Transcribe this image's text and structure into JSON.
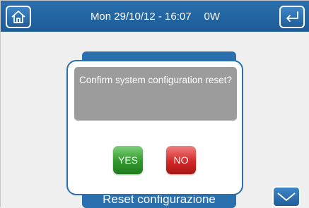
{
  "header": {
    "datetime": "Mon 29/10/12 - 16:07",
    "power": "0W",
    "home_icon": "home-icon",
    "back_icon": "return-arrow-icon"
  },
  "background_screen": {
    "menu_item_label": "Reset configurazione",
    "scroll_down_icon": "chevron-down-icon"
  },
  "dialog": {
    "message": "Confirm system configuration reset?",
    "yes_label": "YES",
    "no_label": "NO"
  },
  "colors": {
    "brand_blue": "#2a6fae",
    "yes_green": "#2f9a2c",
    "no_red": "#d42828",
    "message_gray": "#9c9c9c"
  }
}
